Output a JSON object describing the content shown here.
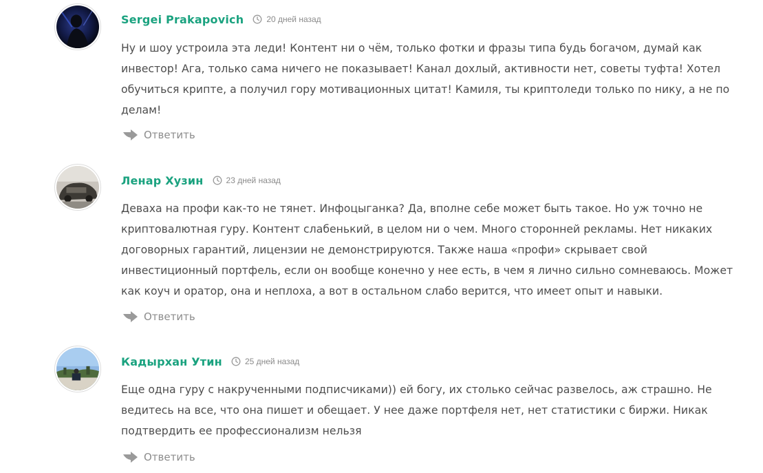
{
  "comments": [
    {
      "author": "Sergei Prakapovich",
      "date": "20 дней назад",
      "avatar_icon": "avatar-dark-figure",
      "text": "Ну и шоу устроила эта леди! Контент ни о чём, только фотки и фразы типа будь богачом, думай как инвестор! Ага, только сама ничего не показывает! Канал дохлый, активности нет, советы туфта! Хотел обучиться крипте, а получил гору мотивационных цитат! Камиля, ты криптоледи только по нику, а не по делам!",
      "reply_label": "Ответить"
    },
    {
      "author": "Ленар Хузин",
      "date": "23 дней назад",
      "avatar_icon": "avatar-car-photo",
      "text": "Деваха на профи как-то не тянет. Инфоцыганка? Да, вполне себе может быть такое. Но уж точно не криптовалютная гуру. Контент слабенький, в целом ни о чем. Много сторонней рекламы. Нет никаких договорных гарантий, лицензии не демонстрируются. Также наша «профи» скрывает свой инвестиционный портфель, если он вообще конечно у нее есть, в чем я лично сильно сомневаюсь. Может как коуч и оратор, она и неплоха, а вот в остальном слабо верится, что имеет опыт и навыки.",
      "reply_label": "Ответить"
    },
    {
      "author": "Кадырхан Утин",
      "date": "25 дней назад",
      "avatar_icon": "avatar-landscape-photo",
      "text": "Еще одна гуру с накрученными подписчиками)) ей богу, их столько сейчас развелось, аж страшно. Не ведитесь на все, что она пишет и обещает. У нее даже портфеля нет, нет статистики с биржи. Никак подтвердить ее профессионализм нельзя",
      "reply_label": "Ответить"
    }
  ],
  "icons": {
    "date": "clock-icon",
    "reply": "reply-arrow-icon"
  },
  "colors": {
    "author": "#1aa27f",
    "text": "#4d4d4d",
    "muted": "#8a8a8a"
  }
}
